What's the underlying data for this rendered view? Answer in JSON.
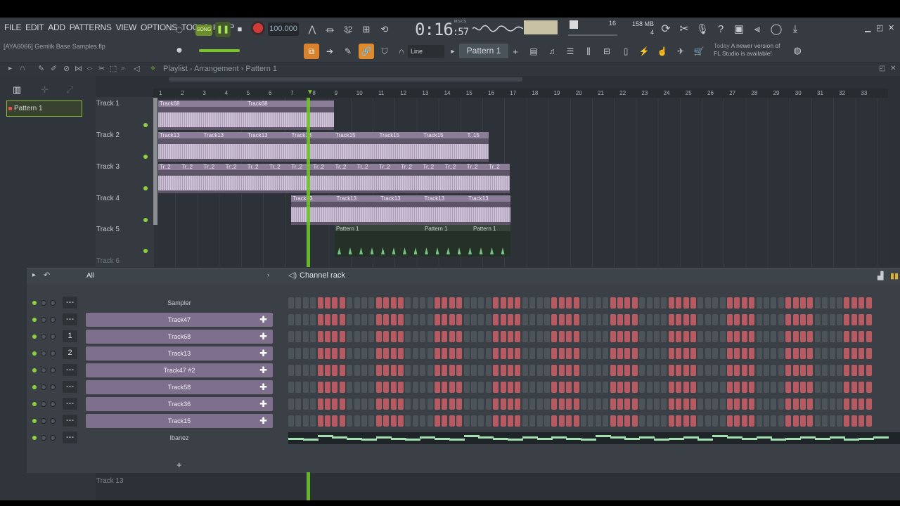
{
  "menu": [
    "FILE",
    "EDIT",
    "ADD",
    "PATTERNS",
    "VIEW",
    "OPTIONS",
    "TOOLS",
    "HELP"
  ],
  "project": {
    "name": "[AYA6066] Gemlik Base Samples.flp"
  },
  "transport": {
    "song_label": "SONG",
    "tempo": "100.000",
    "time": "0:16",
    "time_small": ":57",
    "time_label": "M:S:CS"
  },
  "stats": {
    "pattern_count": "16",
    "memory_top": "158 MB",
    "memory_bottom": "4"
  },
  "snap": "Line",
  "pattern_selector": "Pattern 1",
  "update_notice": {
    "prefix": "Today",
    "line1": "A newer version of",
    "line2": "FL Studio is available!"
  },
  "playlist": {
    "title": "Playlist - Arrangement › Pattern 1",
    "pattern_chip": "Pattern 1",
    "ruler": [
      "1",
      "2",
      "3",
      "4",
      "5",
      "6",
      "7",
      "8",
      "9",
      "10",
      "11",
      "12",
      "13",
      "14",
      "15",
      "16",
      "17",
      "18",
      "19",
      "20",
      "21",
      "22",
      "23",
      "24",
      "25",
      "26",
      "27",
      "28",
      "29",
      "30",
      "31",
      "32",
      "33"
    ],
    "tracks": [
      "Track 1",
      "Track 2",
      "Track 3",
      "Track 4",
      "Track 5",
      "Track 6"
    ],
    "bottom_track": "Track 13",
    "clip_labels": {
      "t1": [
        "Track68",
        "Track68"
      ],
      "t2": [
        "Track13",
        "Track13",
        "Track13",
        "Track13",
        "Track15",
        "Track15",
        "Track15",
        "T..15"
      ],
      "t3": [
        "Tr..2",
        "Tr..2",
        "Tr..2",
        "Tr..2",
        "Tr..2",
        "Tr..2",
        "Tr..2",
        "Tr..2",
        "Tr..2",
        "Tr..2",
        "Tr..2",
        "Tr..2",
        "Tr..2",
        "Tr..2",
        "Tr..2",
        "Tr..2"
      ],
      "t4": [
        "Track13",
        "Track13",
        "Track13",
        "Track13",
        "Track13"
      ],
      "t5": [
        "Pattern 1",
        "Pattern 1",
        "Pattern 1"
      ]
    }
  },
  "channel_rack": {
    "title": "Channel rack",
    "filter": "All",
    "channels": [
      {
        "name": "Sampler",
        "num": "---",
        "kind": "sampler"
      },
      {
        "name": "Track47",
        "num": "---",
        "kind": "track"
      },
      {
        "name": "Track68",
        "num": "1",
        "kind": "track"
      },
      {
        "name": "Track13",
        "num": "2",
        "kind": "track"
      },
      {
        "name": "Track47 #2",
        "num": "---",
        "kind": "track"
      },
      {
        "name": "Track58",
        "num": "---",
        "kind": "track"
      },
      {
        "name": "Track36",
        "num": "---",
        "kind": "track"
      },
      {
        "name": "Track15",
        "num": "---",
        "kind": "track"
      },
      {
        "name": "Ibanez",
        "num": "---",
        "kind": "ibanez"
      }
    ],
    "add_label": "+"
  },
  "colors": {
    "accent_green": "#8fd33a",
    "clip_purple": "#7e6f8d",
    "step_red": "#b85a62",
    "step_dark": "#4c5359"
  }
}
